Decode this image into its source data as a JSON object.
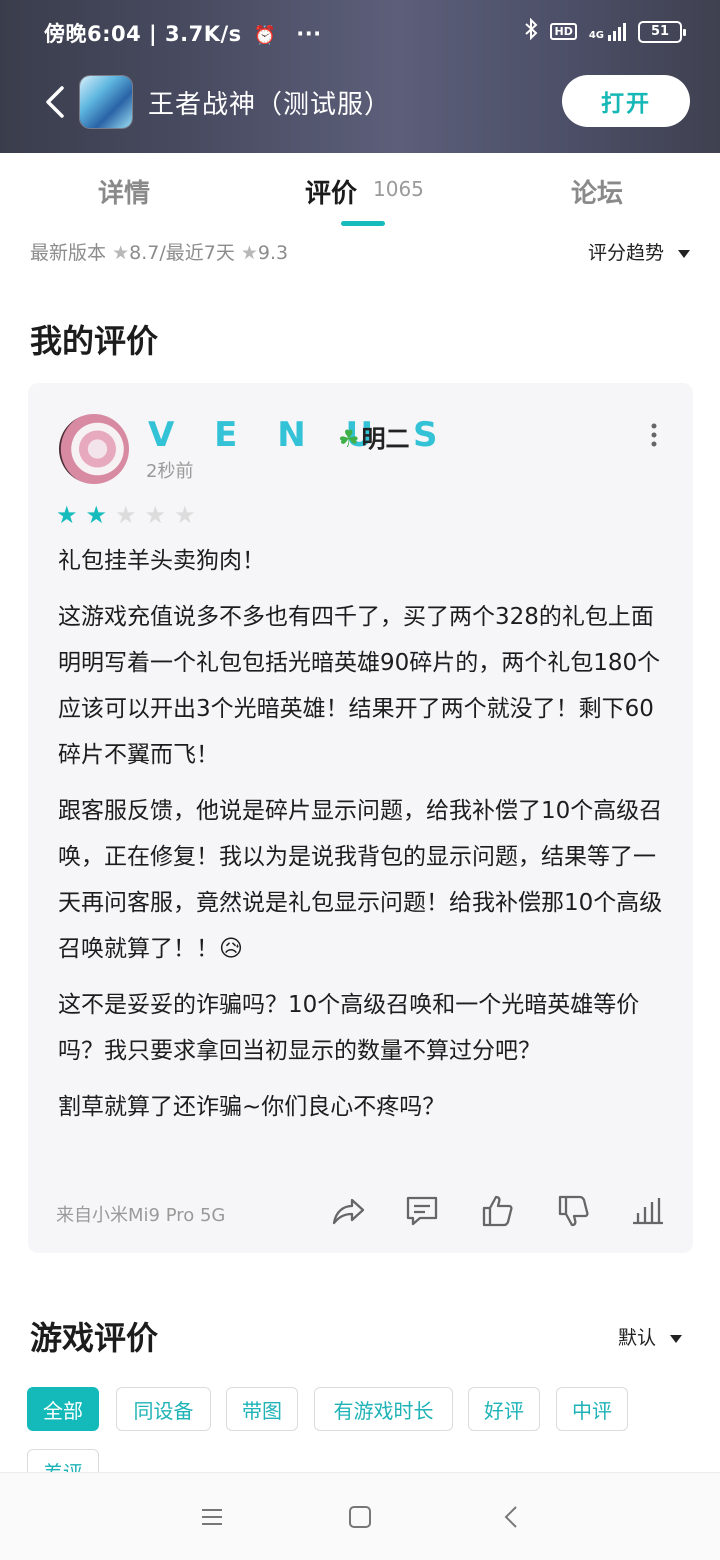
{
  "status_bar": {
    "time": "傍晚6:04 | 3.7K/s",
    "hd": "HD",
    "network": "4G",
    "battery": "51"
  },
  "header": {
    "app_title": "王者战神（测试服）",
    "open_label": "打开"
  },
  "tabs": [
    {
      "label": "详情"
    },
    {
      "label": "评价",
      "count": "1065"
    },
    {
      "label": "论坛"
    }
  ],
  "rating": {
    "latest_label": "最新版本",
    "latest_score": "8.7",
    "recent_label": "/最近7天",
    "recent_score": "9.3",
    "trend_label": "评分趋势"
  },
  "my_review": {
    "section_title": "我的评价",
    "username": "V E N U S",
    "username_suffix": "明二",
    "time_ago": "2秒前",
    "stars": 2,
    "max_stars": 5,
    "paragraphs": [
      "礼包挂羊头卖狗肉！",
      "这游戏充值说多不多也有四千了，买了两个328的礼包上面明明写着一个礼包包括光暗英雄90碎片的，两个礼包180个应该可以开出3个光暗英雄！结果开了两个就没了！剩下60碎片不翼而飞！",
      "跟客服反馈，他说是碎片显示问题，给我补偿了10个高级召唤，正在修复！我以为是说我背包的显示问题，结果等了一天再问客服，竟然说是礼包显示问题！给我补偿那10个高级召唤就算了！！😥",
      "这不是妥妥的诈骗吗？10个高级召唤和一个光暗英雄等价吗？我只要求拿回当初显示的数量不算过分吧？",
      "割草就算了还诈骗~你们良心不疼吗？"
    ],
    "device": "来自小米Mi9 Pro 5G"
  },
  "game_reviews": {
    "section_title": "游戏评价",
    "sort_label": "默认",
    "chips": [
      "全部",
      "同设备",
      "带图",
      "有游戏时长",
      "好评",
      "中评",
      "差评"
    ],
    "active_chip": "全部"
  },
  "colors": {
    "accent": "#16bcbb",
    "username": "#33c2d6"
  }
}
